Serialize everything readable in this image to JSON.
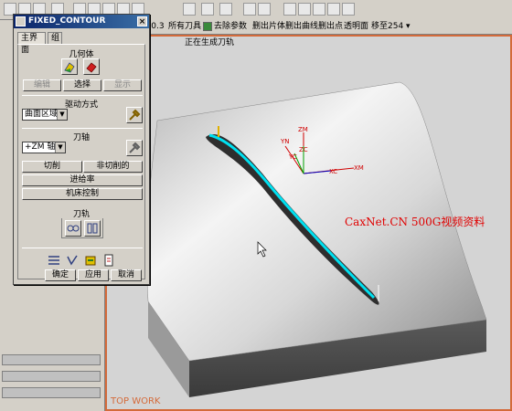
{
  "toolbar2": {
    "items": [
      "-0.3",
      "所有刀具",
      "去除参数",
      "删出片体",
      "删出曲线",
      "删出点",
      "透明面",
      "移至254"
    ]
  },
  "viewport": {
    "title": "正在生成刀轨",
    "view_label": "TOP WORK",
    "watermark": "CaxNet.CN  500G视频资料",
    "axes": {
      "zm": "ZM",
      "yn": "YN",
      "zc": "ZC",
      "xc": "XC",
      "xm": "XM",
      "yc": "YC"
    }
  },
  "dialog": {
    "title": "FIXED_CONTOUR",
    "close": "×",
    "tabs": [
      "主界面",
      "组"
    ],
    "geometry_label": "几何体",
    "edit_button": "编辑",
    "select_button": "选择",
    "display_button": "显示",
    "drive_method_label": "驱动方式",
    "drive_method_value": "曲面区域",
    "tool_axis_label": "刀轴",
    "tool_axis_value": "+ZM 轴",
    "cut_button": "切削",
    "noncut_button": "非切削的",
    "feedrate_button": "进给率",
    "machine_control_button": "机床控制",
    "toolpath_label": "刀轨",
    "ok_button": "确定",
    "apply_button": "应用",
    "cancel_button": "取消"
  },
  "colors": {
    "accent": "#d46a3a",
    "toolpath": "#00e0f0",
    "title_bar": "#0a246a",
    "watermark": "#e00000"
  }
}
